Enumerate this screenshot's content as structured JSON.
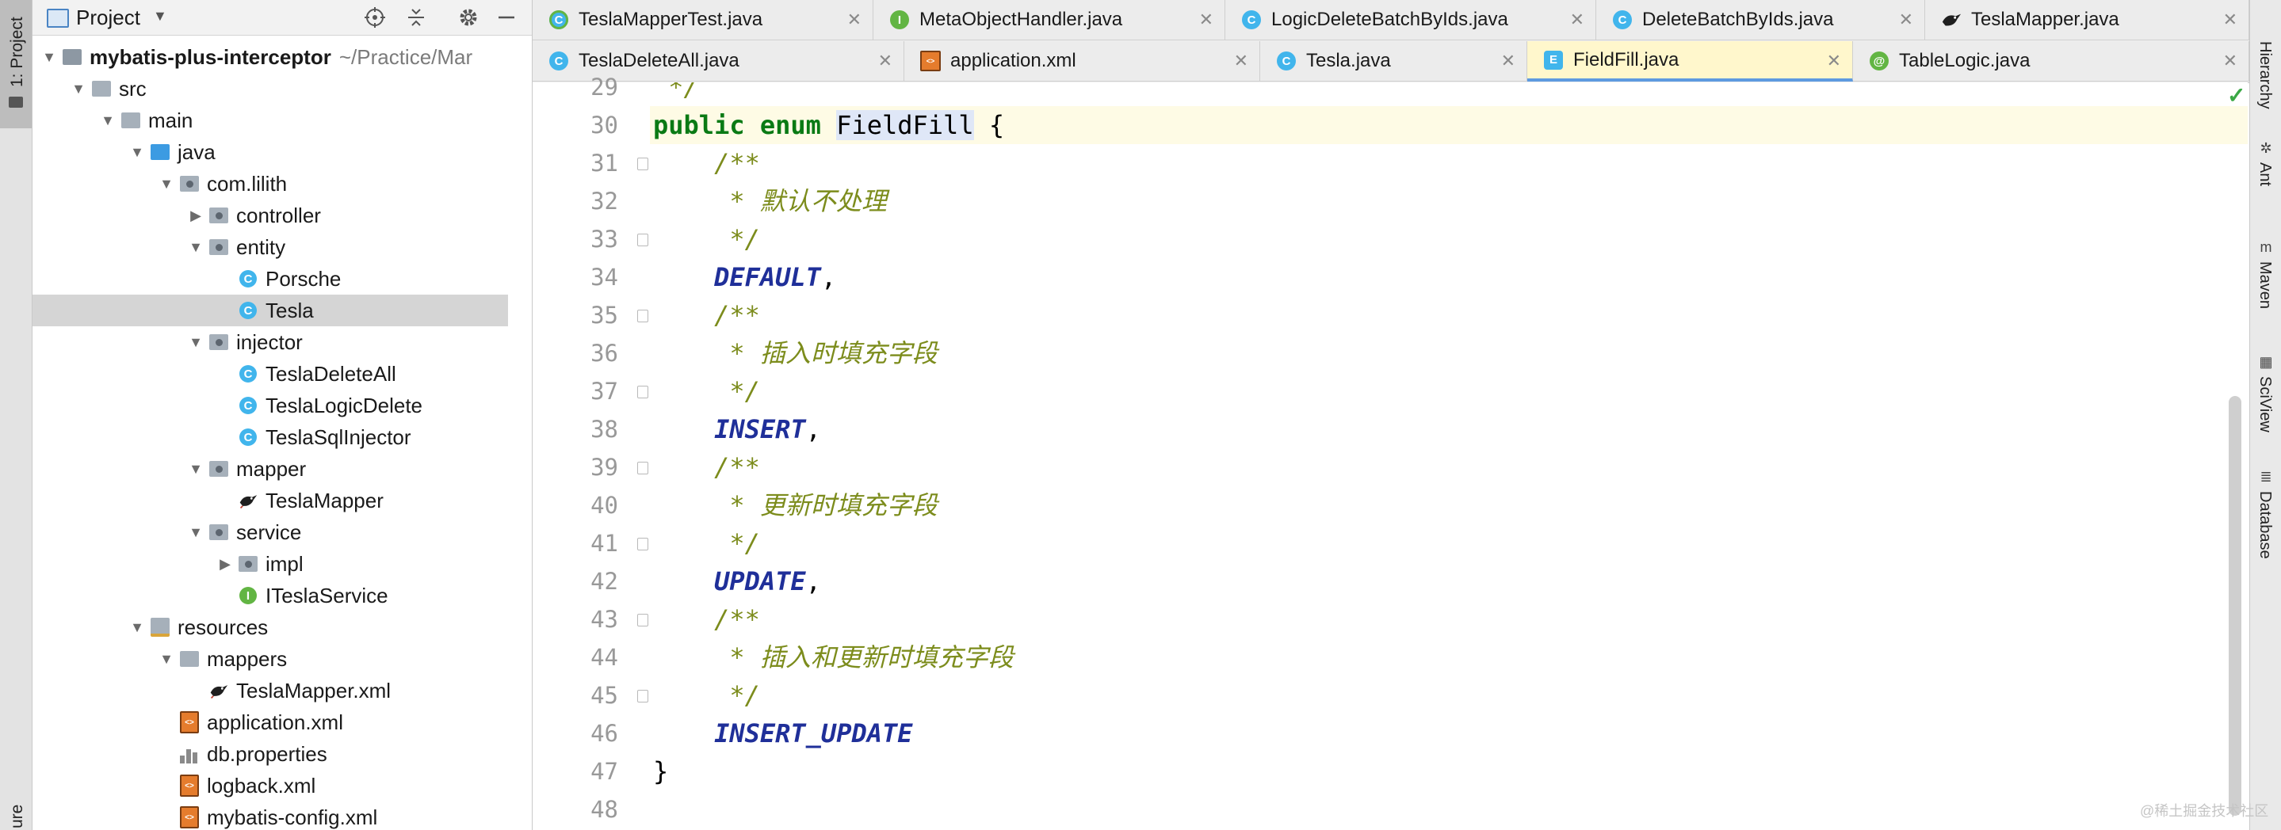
{
  "left_strip": {
    "project_tab": "1: Project",
    "bottom_tab": "ure"
  },
  "project_panel": {
    "title": "Project",
    "tree": [
      {
        "label": "mybatis-plus-interceptor",
        "suffix": "~/Practice/Mar",
        "icon": "module-folder",
        "depth": 0,
        "arrow": "down",
        "bold": true
      },
      {
        "label": "src",
        "icon": "folder",
        "depth": 1,
        "arrow": "down"
      },
      {
        "label": "main",
        "icon": "folder",
        "depth": 2,
        "arrow": "down"
      },
      {
        "label": "java",
        "icon": "source-folder",
        "depth": 3,
        "arrow": "down"
      },
      {
        "label": "com.lilith",
        "icon": "package",
        "depth": 4,
        "arrow": "down"
      },
      {
        "label": "controller",
        "icon": "package",
        "depth": 5,
        "arrow": "right"
      },
      {
        "label": "entity",
        "icon": "package",
        "depth": 5,
        "arrow": "down"
      },
      {
        "label": "Porsche",
        "icon": "class",
        "depth": 6,
        "arrow": ""
      },
      {
        "label": "Tesla",
        "icon": "class",
        "depth": 6,
        "arrow": "",
        "selected": true
      },
      {
        "label": "injector",
        "icon": "package",
        "depth": 5,
        "arrow": "down"
      },
      {
        "label": "TeslaDeleteAll",
        "icon": "class",
        "depth": 6,
        "arrow": ""
      },
      {
        "label": "TeslaLogicDelete",
        "icon": "class",
        "depth": 6,
        "arrow": ""
      },
      {
        "label": "TeslaSqlInjector",
        "icon": "class",
        "depth": 6,
        "arrow": ""
      },
      {
        "label": "mapper",
        "icon": "package",
        "depth": 5,
        "arrow": "down"
      },
      {
        "label": "TeslaMapper",
        "icon": "mybatis-bird",
        "depth": 6,
        "arrow": ""
      },
      {
        "label": "service",
        "icon": "package",
        "depth": 5,
        "arrow": "down"
      },
      {
        "label": "impl",
        "icon": "package",
        "depth": 6,
        "arrow": "right"
      },
      {
        "label": "ITeslaService",
        "icon": "interface",
        "depth": 6,
        "arrow": ""
      },
      {
        "label": "resources",
        "icon": "resources-folder",
        "depth": 3,
        "arrow": "down"
      },
      {
        "label": "mappers",
        "icon": "folder",
        "depth": 4,
        "arrow": "down"
      },
      {
        "label": "TeslaMapper.xml",
        "icon": "mybatis-bird",
        "depth": 5,
        "arrow": ""
      },
      {
        "label": "application.xml",
        "icon": "xml",
        "depth": 4,
        "arrow": ""
      },
      {
        "label": "db.properties",
        "icon": "properties",
        "depth": 4,
        "arrow": ""
      },
      {
        "label": "logback.xml",
        "icon": "xml",
        "depth": 4,
        "arrow": ""
      },
      {
        "label": "mybatis-config.xml",
        "icon": "xml",
        "depth": 4,
        "arrow": ""
      }
    ]
  },
  "tabs": {
    "row1": [
      {
        "label": "TeslaMapperTest.java",
        "icon": "test-class-icon"
      },
      {
        "label": "MetaObjectHandler.java",
        "icon": "interface-icon"
      },
      {
        "label": "LogicDeleteBatchByIds.java",
        "icon": "class-icon"
      },
      {
        "label": "DeleteBatchByIds.java",
        "icon": "class-icon"
      },
      {
        "label": "TeslaMapper.java",
        "icon": "mybatis-bird-icon"
      }
    ],
    "row2": [
      {
        "label": "TeslaDeleteAll.java",
        "icon": "class-icon"
      },
      {
        "label": "application.xml",
        "icon": "xml-icon"
      },
      {
        "label": "Tesla.java",
        "icon": "class-icon"
      },
      {
        "label": "FieldFill.java",
        "icon": "enum-icon",
        "active": true
      },
      {
        "label": "TableLogic.java",
        "icon": "annotation-icon"
      }
    ]
  },
  "editor": {
    "lines": [
      {
        "n": "29",
        "parts": [
          {
            "t": " */",
            "c": "comment"
          }
        ]
      },
      {
        "n": "30",
        "current": true,
        "parts": [
          {
            "t": "public enum ",
            "c": "kw"
          },
          {
            "t": "FieldFill",
            "c": "ident"
          },
          {
            "t": " {",
            "c": "brace"
          }
        ]
      },
      {
        "n": "31",
        "fold": true,
        "parts": [
          {
            "t": "    /**",
            "c": "comment"
          }
        ]
      },
      {
        "n": "32",
        "parts": [
          {
            "t": "     * 默认不处理",
            "c": "comment"
          }
        ]
      },
      {
        "n": "33",
        "fold": true,
        "parts": [
          {
            "t": "     */",
            "c": "comment"
          }
        ]
      },
      {
        "n": "34",
        "parts": [
          {
            "t": "    DEFAULT",
            "c": "const"
          },
          {
            "t": ",",
            "c": "plain"
          }
        ]
      },
      {
        "n": "35",
        "fold": true,
        "parts": [
          {
            "t": "    /**",
            "c": "comment"
          }
        ]
      },
      {
        "n": "36",
        "parts": [
          {
            "t": "     * 插入时填充字段",
            "c": "comment"
          }
        ]
      },
      {
        "n": "37",
        "fold": true,
        "parts": [
          {
            "t": "     */",
            "c": "comment"
          }
        ]
      },
      {
        "n": "38",
        "parts": [
          {
            "t": "    INSERT",
            "c": "const"
          },
          {
            "t": ",",
            "c": "plain"
          }
        ]
      },
      {
        "n": "39",
        "fold": true,
        "parts": [
          {
            "t": "    /**",
            "c": "comment"
          }
        ]
      },
      {
        "n": "40",
        "parts": [
          {
            "t": "     * 更新时填充字段",
            "c": "comment"
          }
        ]
      },
      {
        "n": "41",
        "fold": true,
        "parts": [
          {
            "t": "     */",
            "c": "comment"
          }
        ]
      },
      {
        "n": "42",
        "parts": [
          {
            "t": "    UPDATE",
            "c": "const"
          },
          {
            "t": ",",
            "c": "plain"
          }
        ]
      },
      {
        "n": "43",
        "fold": true,
        "parts": [
          {
            "t": "    /**",
            "c": "comment"
          }
        ]
      },
      {
        "n": "44",
        "parts": [
          {
            "t": "     * 插入和更新时填充字段",
            "c": "comment"
          }
        ]
      },
      {
        "n": "45",
        "fold": true,
        "parts": [
          {
            "t": "     */",
            "c": "comment"
          }
        ]
      },
      {
        "n": "46",
        "parts": [
          {
            "t": "    INSERT_UPDATE",
            "c": "const"
          }
        ]
      },
      {
        "n": "47",
        "parts": [
          {
            "t": "}",
            "c": "plain"
          }
        ]
      },
      {
        "n": "48",
        "parts": []
      }
    ]
  },
  "right_strip": [
    "Hierarchy",
    "Ant",
    "Maven",
    "SciView",
    "Database"
  ],
  "watermark": "@稀土掘金技术社区",
  "colors": {
    "keyword": "#0a7a14",
    "comment": "#7c8c1c",
    "constant": "#1f2f99",
    "active_tab": "#fff7cc",
    "selection": "#d5d5d5"
  }
}
